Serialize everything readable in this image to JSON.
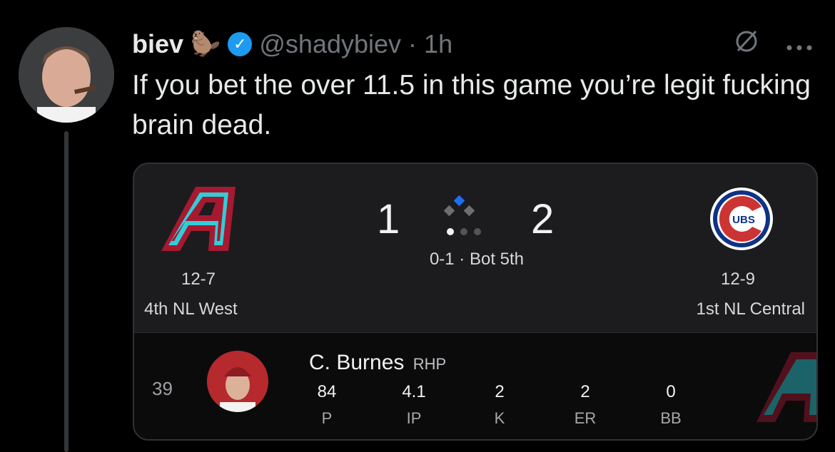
{
  "tweet": {
    "display_name": "biev",
    "name_emoji": "🦫",
    "handle": "@shadybiev",
    "separator": "·",
    "time": "1h",
    "text": "If you bet the over 11.5 in this game you’re legit fucking brain dead."
  },
  "colors": {
    "background": "#000000",
    "verified": "#1d9bf0",
    "card": "#1c1c1e",
    "dbacks_red": "#a71930",
    "dbacks_teal": "#30ced8",
    "cubs_blue": "#0e3386",
    "cubs_red": "#cc3433"
  },
  "game": {
    "away": {
      "score": "1",
      "record": "12-7",
      "standing": "4th NL West",
      "logo": "arizona-diamondbacks-logo"
    },
    "home": {
      "score": "2",
      "record": "12-9",
      "standing": "1st NL Central",
      "logo": "chicago-cubs-logo",
      "logo_text": "UBS"
    },
    "status": "0-1 · Bot 5th",
    "outs": 1,
    "pitcher": {
      "number": "39",
      "name": "C. Burnes",
      "position": "RHP",
      "stats": [
        {
          "value": "84",
          "label": "P"
        },
        {
          "value": "4.1",
          "label": "IP"
        },
        {
          "value": "2",
          "label": "K"
        },
        {
          "value": "2",
          "label": "ER"
        },
        {
          "value": "0",
          "label": "BB"
        }
      ]
    }
  }
}
